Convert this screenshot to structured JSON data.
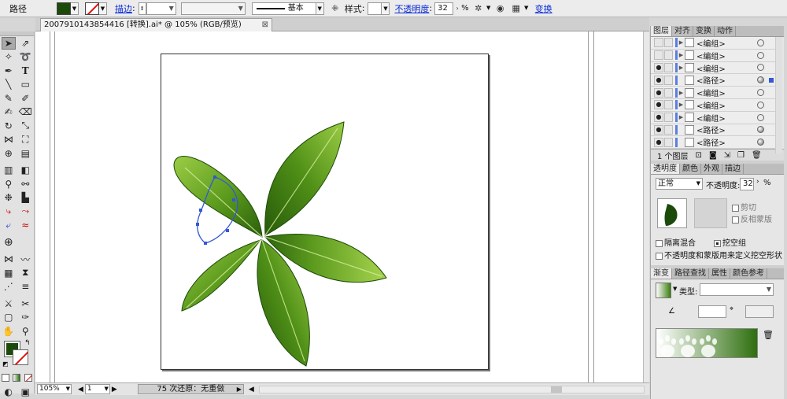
{
  "control_bar": {
    "object_type": "路径",
    "stroke_label": "描边",
    "brush_label": "基本",
    "style_label": "样式",
    "opacity_label": "不透明度",
    "opacity_value": "32",
    "percent": "%",
    "transform_label": "变换"
  },
  "document": {
    "tab_title": "2007910143854416 [转换].ai* @ 105% (RGB/预览)"
  },
  "status_bar": {
    "zoom": "105%",
    "artboard": "1",
    "status_text": "75 次还原：无重做"
  },
  "layers_panel": {
    "tabs": [
      "图层",
      "对齐",
      "变换",
      "动作"
    ],
    "rows": [
      {
        "name": "<编组>",
        "visible": false,
        "expand": true,
        "target": "hollow"
      },
      {
        "name": "<编组>",
        "visible": false,
        "expand": true,
        "target": "hollow"
      },
      {
        "name": "<编组>",
        "visible": true,
        "expand": true,
        "target": "hollow"
      },
      {
        "name": "<路径>",
        "visible": true,
        "expand": false,
        "target": "filled",
        "selected": true
      },
      {
        "name": "<编组>",
        "visible": true,
        "expand": true,
        "target": "hollow"
      },
      {
        "name": "<编组>",
        "visible": true,
        "expand": true,
        "target": "hollow"
      },
      {
        "name": "<编组>",
        "visible": true,
        "expand": true,
        "target": "hollow"
      },
      {
        "name": "<路径>",
        "visible": true,
        "expand": false,
        "target": "filled"
      },
      {
        "name": "<路径>",
        "visible": true,
        "expand": false,
        "target": "filled"
      }
    ],
    "footer_count": "1 个图层"
  },
  "transparency_panel": {
    "tabs": [
      "透明度",
      "颜色",
      "外观",
      "描边"
    ],
    "blend_mode": "正常",
    "opacity_label": "不透明度:",
    "opacity_value": "32",
    "percent": "%",
    "clip_label": "剪切",
    "invert_mask_label": "反相蒙版",
    "isolate_label": "隔离混合",
    "knockout_label": "挖空组",
    "define_knockout_label": "不透明度和蒙版用来定义挖空形状"
  },
  "gradient_panel": {
    "tabs": [
      "渐变",
      "路径查找",
      "属性",
      "颜色参考"
    ],
    "type_label": "类型:"
  },
  "colors": {
    "fill": "#1b4a0a",
    "leaf_dark": "#2f6b0f",
    "leaf_light": "#8cc43a",
    "selection": "#3457d5"
  }
}
